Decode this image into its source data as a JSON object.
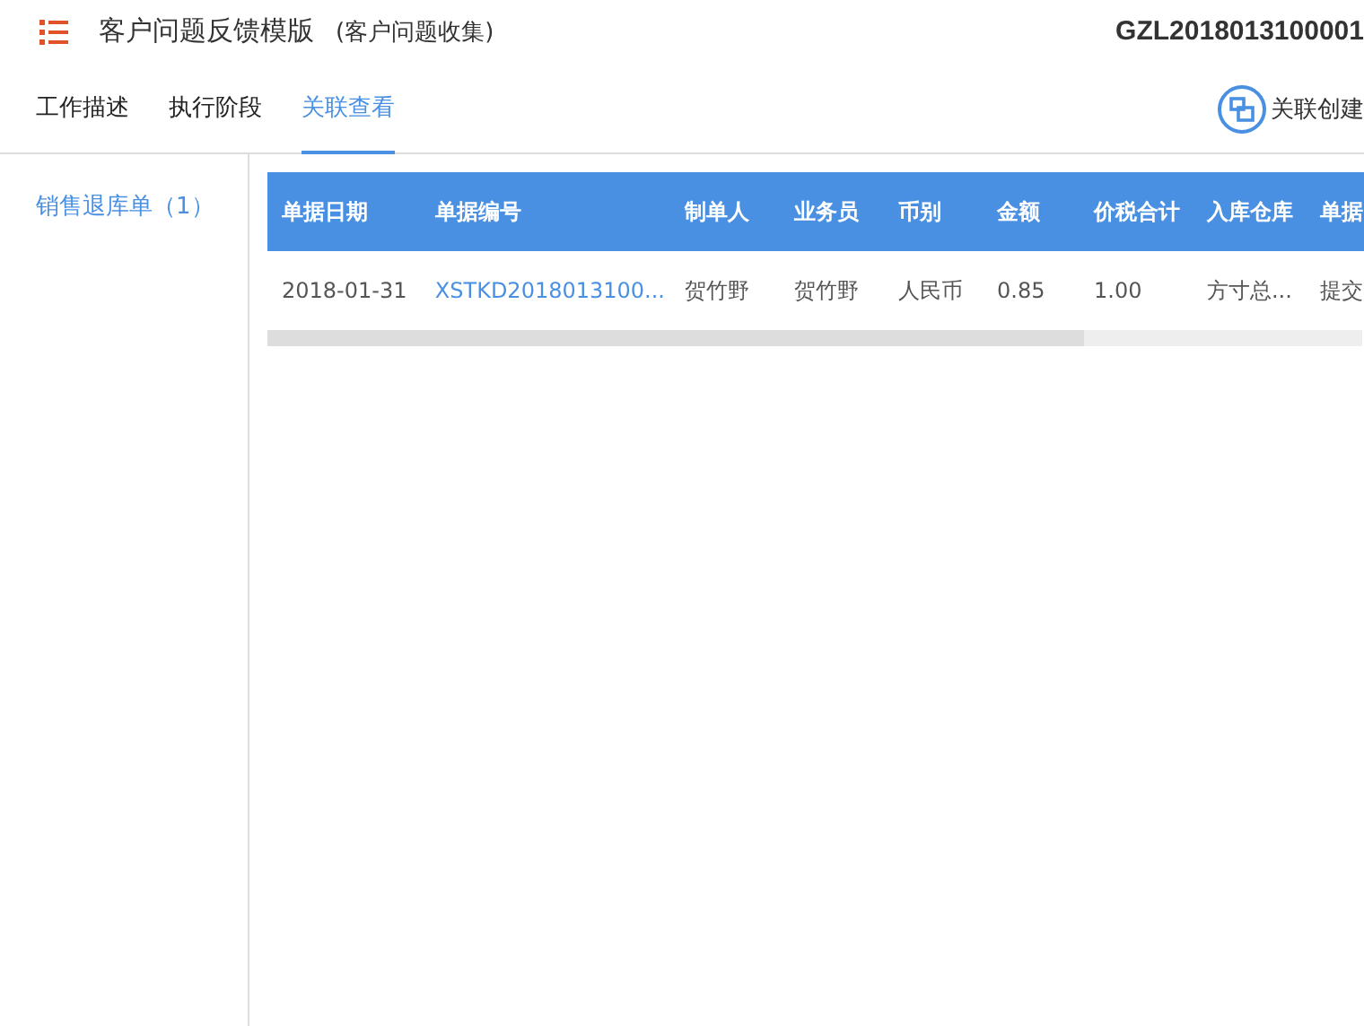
{
  "header": {
    "title": "客户问题反馈模版",
    "subtitle": "(客户问题收集)",
    "code": "GZL2018013100001"
  },
  "tabs": [
    {
      "label": "工作描述",
      "selected": false
    },
    {
      "label": "执行阶段",
      "selected": false
    },
    {
      "label": "关联查看",
      "selected": true
    }
  ],
  "action": {
    "label": "关联创建"
  },
  "sidebar": {
    "items": [
      {
        "label": "销售退库单（1）",
        "selected": true
      }
    ]
  },
  "table": {
    "columns": [
      "单据日期",
      "单据编号",
      "制单人",
      "业务员",
      "币别",
      "金额",
      "价税合计",
      "入库仓库",
      "单据"
    ],
    "rows": [
      {
        "cells": [
          {
            "text": "2018-01-31",
            "kind": "text"
          },
          {
            "text": "XSTKD2018013100...",
            "kind": "link"
          },
          {
            "text": "贺竹野",
            "kind": "text"
          },
          {
            "text": "贺竹野",
            "kind": "text"
          },
          {
            "text": "人民币",
            "kind": "text"
          },
          {
            "text": "0.85",
            "kind": "text"
          },
          {
            "text": "1.00",
            "kind": "text"
          },
          {
            "text": "方寸总...",
            "kind": "text"
          },
          {
            "text": "提交",
            "kind": "text"
          }
        ]
      }
    ]
  }
}
